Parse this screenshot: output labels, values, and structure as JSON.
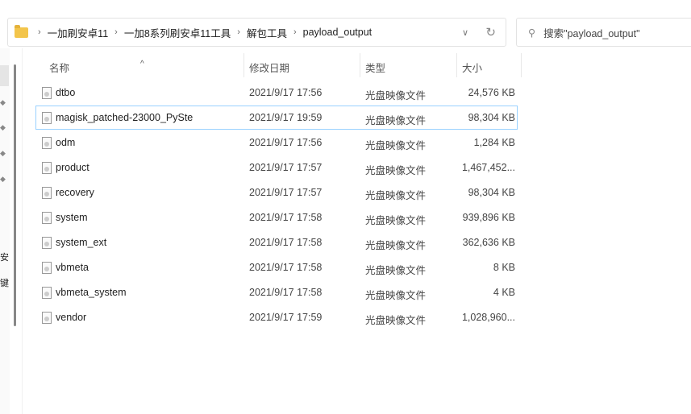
{
  "breadcrumb": [
    "一加刷安卓11",
    "一加8系列刷安卓11工具",
    "解包工具",
    "payload_output"
  ],
  "search": {
    "placeholder": "搜索\"payload_output\""
  },
  "nav": {
    "chars": [
      "安",
      "键"
    ]
  },
  "columns": {
    "name": "名称",
    "date": "修改日期",
    "type": "类型",
    "size": "大小"
  },
  "files": [
    {
      "name": "dtbo",
      "date": "2021/9/17 17:56",
      "type": "光盘映像文件",
      "size": "24,576 KB"
    },
    {
      "name": "magisk_patched-23000_PySte",
      "date": "2021/9/17 19:59",
      "type": "光盘映像文件",
      "size": "98,304 KB",
      "selected": true
    },
    {
      "name": "odm",
      "date": "2021/9/17 17:56",
      "type": "光盘映像文件",
      "size": "1,284 KB"
    },
    {
      "name": "product",
      "date": "2021/9/17 17:57",
      "type": "光盘映像文件",
      "size": "1,467,452..."
    },
    {
      "name": "recovery",
      "date": "2021/9/17 17:57",
      "type": "光盘映像文件",
      "size": "98,304 KB"
    },
    {
      "name": "system",
      "date": "2021/9/17 17:58",
      "type": "光盘映像文件",
      "size": "939,896 KB"
    },
    {
      "name": "system_ext",
      "date": "2021/9/17 17:58",
      "type": "光盘映像文件",
      "size": "362,636 KB"
    },
    {
      "name": "vbmeta",
      "date": "2021/9/17 17:58",
      "type": "光盘映像文件",
      "size": "8 KB"
    },
    {
      "name": "vbmeta_system",
      "date": "2021/9/17 17:58",
      "type": "光盘映像文件",
      "size": "4 KB"
    },
    {
      "name": "vendor",
      "date": "2021/9/17 17:59",
      "type": "光盘映像文件",
      "size": "1,028,960..."
    }
  ]
}
